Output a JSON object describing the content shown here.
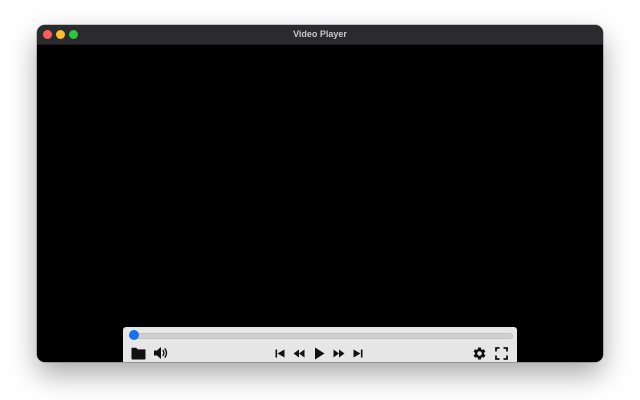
{
  "window": {
    "title": "Video Player",
    "traffic_lights": [
      {
        "name": "close",
        "color": "#ff5f57"
      },
      {
        "name": "minimize",
        "color": "#febc2e"
      },
      {
        "name": "zoom",
        "color": "#28c840"
      }
    ]
  },
  "player": {
    "background": "#000000",
    "playback_progress": 0.0,
    "accent_color": "#1670f0",
    "controls_left": [
      "folder-icon",
      "volume-icon"
    ],
    "controls_center": [
      "skip-previous-icon",
      "rewind-icon",
      "play-icon",
      "fast-forward-icon",
      "skip-next-icon"
    ],
    "controls_right": [
      "gear-icon",
      "fullscreen-icon"
    ]
  }
}
